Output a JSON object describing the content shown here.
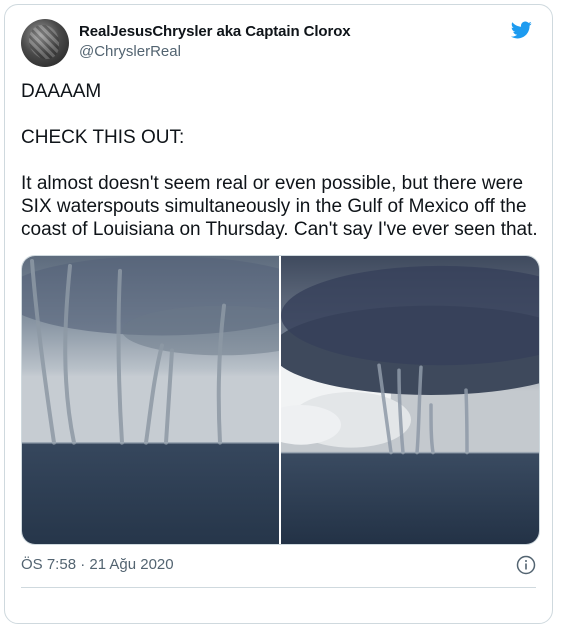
{
  "author": {
    "display_name": "RealJesusChrysler aka Captain Clorox",
    "handle": "@ChryslerReal"
  },
  "tweet": {
    "text": "DAAAAM\n\nCHECK THIS OUT:\n\nIt almost doesn't seem real or even possible, but there were SIX waterspouts simultaneously in the Gulf of Mexico off the coast of Louisiana on Thursday. Can't say I've ever seen that.",
    "timestamp": "ÖS 7:58 · 21 Ağu 2020"
  },
  "media": {
    "photos": [
      {
        "subject": "waterspouts over sea under storm clouds"
      },
      {
        "subject": "waterspouts under dark cloud with white cumulus and sea"
      }
    ]
  },
  "icons": {
    "brand": "twitter-bird-icon",
    "info": "info-icon"
  },
  "colors": {
    "brand_blue": "#1d9bf0",
    "secondary_text": "#536471",
    "border": "#cfd9de"
  }
}
